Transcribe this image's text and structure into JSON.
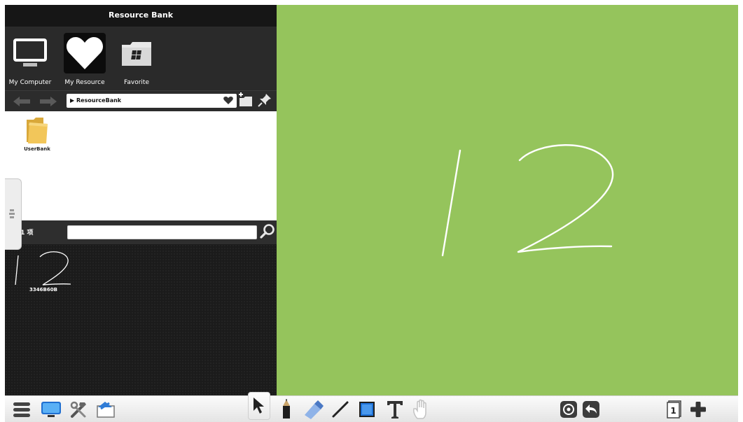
{
  "panel": {
    "title": "Resource Bank",
    "sources": [
      {
        "label": "My Computer",
        "icon": "monitor-icon"
      },
      {
        "label": "My Resource",
        "icon": "heart-icon",
        "active": true
      },
      {
        "label": "Favorite",
        "icon": "windows-folder-icon"
      }
    ],
    "nav": {
      "path": "▶ ResourceBank"
    },
    "files": [
      {
        "name": "UserBank",
        "icon": "folder-icon"
      }
    ],
    "search": {
      "count_label": "共 1 项",
      "value": "",
      "placeholder": ""
    },
    "thumbnails": [
      {
        "size": "3346B60B"
      }
    ]
  },
  "canvas": {
    "background": "#95c45c",
    "ink_color": "#ffffff"
  },
  "toolbar": {
    "left_icons": [
      "menu-icon",
      "screen-icon",
      "tools-icon",
      "board-icon"
    ],
    "drawing_tools": [
      "select-icon",
      "pencil-icon",
      "eraser-icon",
      "line-icon",
      "rectangle-icon",
      "text-icon",
      "hand-icon"
    ],
    "selected_tool": "select-icon",
    "history_tools": [
      "target-icon",
      "undo-icon"
    ],
    "page": {
      "number": "1"
    }
  }
}
